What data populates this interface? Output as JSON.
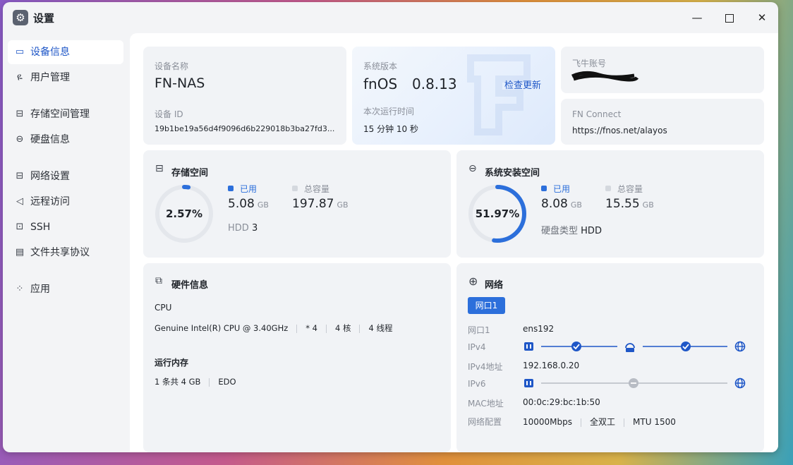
{
  "window": {
    "title": "设置"
  },
  "sidebar": {
    "items": [
      {
        "label": "设备信息",
        "icon": "monitor-icon",
        "active": true
      },
      {
        "label": "用户管理",
        "icon": "user-icon"
      },
      {
        "label": "存储空间管理",
        "icon": "storage-icon"
      },
      {
        "label": "硬盘信息",
        "icon": "disk-icon"
      },
      {
        "label": "网络设置",
        "icon": "network-icon"
      },
      {
        "label": "远程访问",
        "icon": "send-icon"
      },
      {
        "label": "SSH",
        "icon": "terminal-icon"
      },
      {
        "label": "文件共享协议",
        "icon": "file-icon"
      },
      {
        "label": "应用",
        "icon": "apps-icon"
      }
    ]
  },
  "device": {
    "name_label": "设备名称",
    "name": "FN-NAS",
    "id_label": "设备 ID",
    "id": "19b1be19a56d4f9096d6b229018b3ba27fd3..."
  },
  "version": {
    "label": "系统版本",
    "os": "fnOS",
    "number": "0.8.13",
    "check_update": "检查更新",
    "uptime_label": "本次运行时间",
    "uptime": "15 分钟 10 秒"
  },
  "account": {
    "label": "飞牛账号",
    "fn_connect_label": "FN Connect",
    "fn_connect_url": "https://fnos.net/alayos"
  },
  "storage": {
    "title": "存储空间",
    "percent_text": "2.57%",
    "percent": 2.57,
    "used_label": "已用",
    "used": "5.08",
    "used_unit": "GB",
    "total_label": "总容量",
    "total": "197.87",
    "total_unit": "GB",
    "disk_type": "HDD",
    "disk_count": "3"
  },
  "sys_space": {
    "title": "系统安装空间",
    "percent_text": "51.97%",
    "percent": 51.97,
    "used_label": "已用",
    "used": "8.08",
    "used_unit": "GB",
    "total_label": "总容量",
    "total": "15.55",
    "total_unit": "GB",
    "disk_type_label": "硬盘类型",
    "disk_type": "HDD"
  },
  "hardware": {
    "title": "硬件信息",
    "cpu_label": "CPU",
    "cpu_model": "Genuine Intel(R) CPU @ 3.40GHz",
    "cpu_count": "* 4",
    "cores": "4 核",
    "threads": "4 线程",
    "mem_label": "运行内存",
    "mem_sticks": "1 条共 4 GB",
    "mem_type": "EDO"
  },
  "network": {
    "title": "网络",
    "tab": "网口1",
    "port_label": "网口1",
    "port_value": "ens192",
    "ipv4_label": "IPv4",
    "ipv4_addr_label": "IPv4地址",
    "ipv4_addr": "192.168.0.20",
    "ipv6_label": "IPv6",
    "mac_label": "MAC地址",
    "mac": "00:0c:29:bc:1b:50",
    "config_label": "网络配置",
    "speed": "10000Mbps",
    "duplex": "全双工",
    "mtu": "MTU 1500"
  },
  "colors": {
    "accent": "#2c6fdb",
    "ring_track": "#e4e7ec",
    "legend_total": "#d4d8de",
    "status_ok": "#1f57c7",
    "status_off": "#b8bcc4"
  }
}
